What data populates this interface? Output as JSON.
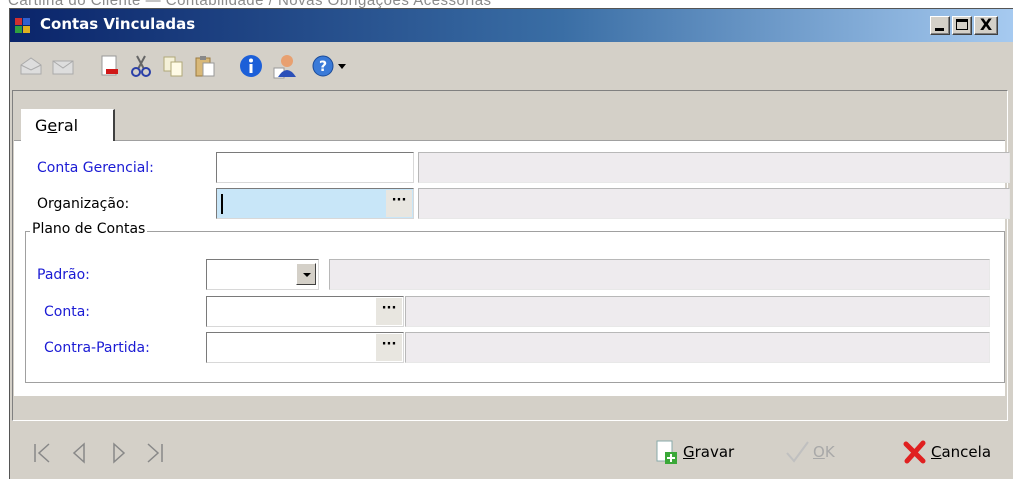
{
  "page_caption": "Cartilha do Cliente — Contabilidade / Novas Obrigações Acessórias",
  "window": {
    "title": "Contas Vinculadas",
    "min_glyph": "",
    "close_glyph": "X"
  },
  "toolbar": {
    "icons": [
      "mail-open-icon",
      "mail-icon",
      "new-document-icon",
      "cut-icon",
      "copy-icon",
      "paste-icon",
      "info-icon",
      "user-icon",
      "help-icon",
      "dropdown-arrow-icon"
    ]
  },
  "tabs": [
    {
      "label_pre": "G",
      "label_underlined": "e",
      "label_post": "ral"
    }
  ],
  "form": {
    "conta_gerencial": {
      "label": "Conta Gerencial:",
      "value": "",
      "description": ""
    },
    "organizacao": {
      "label": "Organização:",
      "value": "",
      "description": ""
    },
    "plano_de_contas": {
      "legend": "Plano de Contas",
      "padrao": {
        "label": "Padrão:",
        "value": "",
        "description": ""
      },
      "conta": {
        "label": "Conta:",
        "value": "",
        "description": ""
      },
      "contra_partida": {
        "label": "Contra-Partida:",
        "value": "",
        "description": ""
      }
    }
  },
  "footer": {
    "nav": [
      "first-record-icon",
      "previous-record-icon",
      "next-record-icon",
      "last-record-icon"
    ],
    "gravar_label": "Gravar",
    "ok_label": "OK",
    "cancela_label": "Cancela"
  },
  "colors": {
    "required_label": "#1b1bd4",
    "title_gradient_start": "#0a246a",
    "focused_field": "#c8e6f8",
    "window_bg": "#d4d0c8"
  }
}
